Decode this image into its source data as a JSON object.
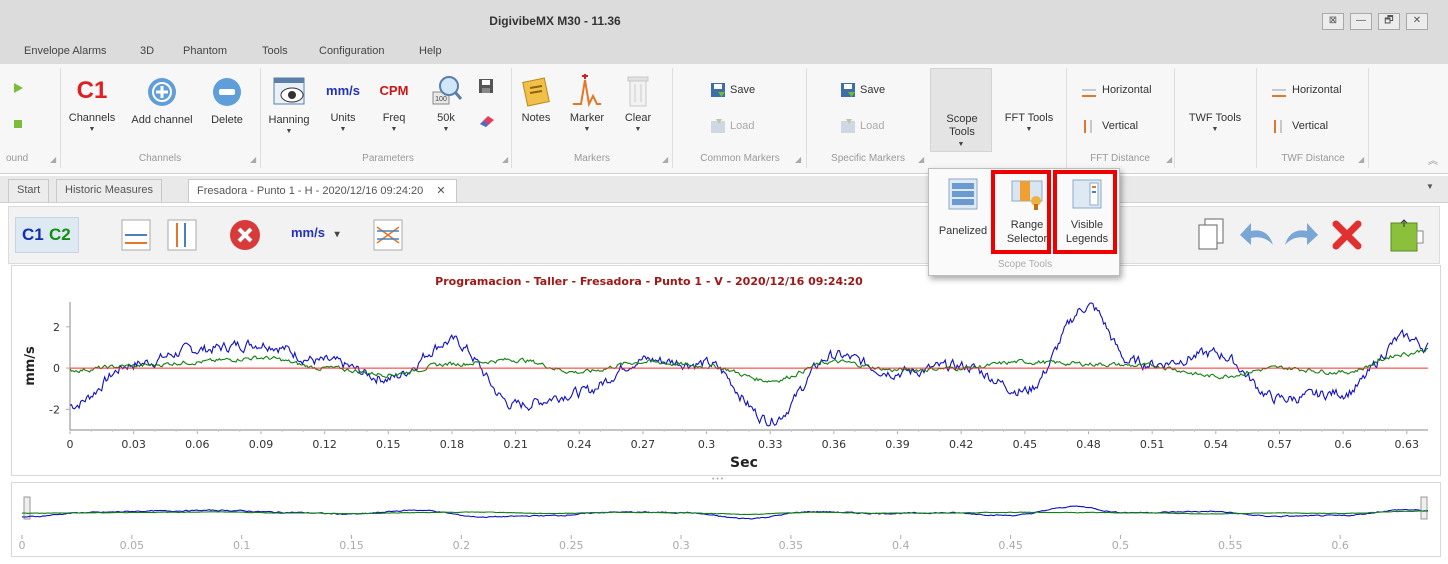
{
  "window": {
    "title": "DigivibeMX M30 - 11.36",
    "controls": [
      "⊠",
      "—",
      "🗗",
      "✕"
    ]
  },
  "menu": [
    "Envelope Alarms",
    "3D",
    "Phantom",
    "Tools",
    "Configuration",
    "Help"
  ],
  "ribbon": {
    "cut_group": {
      "label": "ound"
    },
    "channels": {
      "label": "Channels",
      "c1_badge": "C1",
      "buttons": [
        "Channels",
        "Add channel",
        "Delete"
      ]
    },
    "parameters": {
      "label": "Parameters",
      "units_text": "mm/s",
      "freq_text": "CPM",
      "hanning_badge": "100",
      "buttons": [
        "Hanning",
        "Units",
        "Freq",
        "50k"
      ]
    },
    "markers": {
      "label": "Markers",
      "buttons": [
        "Notes",
        "Marker",
        "Clear"
      ]
    },
    "common_markers": {
      "label": "Common Markers",
      "save": "Save",
      "load": "Load"
    },
    "specific_markers": {
      "label": "Specific Markers",
      "save": "Save",
      "load": "Load"
    },
    "scope_tools": {
      "label": "Scope Tools"
    },
    "fft_tools": {
      "label": "FFT Tools"
    },
    "fft_distance": {
      "label": "FFT Distance",
      "horizontal": "Horizontal",
      "vertical": "Vertical"
    },
    "twf_tools": {
      "label": "TWF Tools"
    },
    "twf_distance": {
      "label": "TWF Distance",
      "horizontal": "Horizontal",
      "vertical": "Vertical"
    }
  },
  "tabs": [
    {
      "label": "Start"
    },
    {
      "label": "Historic Measures"
    },
    {
      "label": "Fresadora - Punto 1 - H - 2020/12/16 09:24:20",
      "close": "✕"
    }
  ],
  "toolbar": {
    "c1": "C1",
    "c2": "C2",
    "units": "mm/s",
    "units_arrow": "▾"
  },
  "popup": {
    "buttons": [
      "Panelized",
      "Range Selector",
      "Visible Legends"
    ],
    "group_label": "Scope Tools"
  },
  "chart_data": [
    {
      "type": "line",
      "title": "Programacion - Taller - Fresadora - Punto 1 - V - 2020/12/16 09:24:20",
      "xlabel": "Sec",
      "ylabel": "mm/s",
      "xlim": [
        0,
        0.64
      ],
      "ylim": [
        -3,
        3.2
      ],
      "x_ticks": [
        "0",
        "0.03",
        "0.06",
        "0.09",
        "0.12",
        "0.15",
        "0.18",
        "0.21",
        "0.24",
        "0.27",
        "0.3",
        "0.33",
        "0.36",
        "0.39",
        "0.42",
        "0.45",
        "0.48",
        "0.51",
        "0.54",
        "0.57",
        "0.6",
        "0.63"
      ],
      "y_ticks": [
        "2",
        "0",
        "-2"
      ],
      "series": [
        {
          "color": "#1010c8",
          "x": [
            0,
            0.03,
            0.06,
            0.09,
            0.12,
            0.15,
            0.18,
            0.21,
            0.24,
            0.27,
            0.3,
            0.33,
            0.36,
            0.39,
            0.42,
            0.45,
            0.48,
            0.5,
            0.51,
            0.54,
            0.57,
            0.6,
            0.63,
            0.64
          ],
          "y": [
            -1.8,
            0.2,
            0.9,
            1.2,
            0.3,
            -0.5,
            1.3,
            -1.8,
            -1.2,
            0.4,
            0.2,
            -2.5,
            0.6,
            -0.2,
            0.1,
            -1.1,
            3.0,
            0.3,
            0.2,
            0.7,
            -1.5,
            -1.2,
            1.5,
            1.0
          ]
        },
        {
          "color": "#108010",
          "x": [
            0,
            0.03,
            0.06,
            0.09,
            0.12,
            0.15,
            0.18,
            0.21,
            0.24,
            0.27,
            0.3,
            0.33,
            0.36,
            0.39,
            0.42,
            0.45,
            0.48,
            0.51,
            0.54,
            0.57,
            0.6,
            0.63,
            0.64
          ],
          "y": [
            -0.1,
            0.1,
            0.3,
            0.5,
            0.0,
            -0.3,
            0.2,
            0.4,
            -0.2,
            0.3,
            0.1,
            -0.6,
            0.3,
            -0.1,
            0.0,
            0.3,
            0.2,
            0.1,
            -0.4,
            0.0,
            -0.2,
            0.7,
            0.9
          ]
        },
        {
          "color": "#ff2a2a",
          "x": [
            0,
            0.64
          ],
          "y": [
            0,
            0
          ]
        }
      ]
    },
    {
      "type": "line",
      "title": "",
      "xlim": [
        0,
        0.64
      ],
      "x_ticks": [
        "0",
        "0.05",
        "0.1",
        "0.15",
        "0.2",
        "0.25",
        "0.3",
        "0.35",
        "0.4",
        "0.45",
        "0.5",
        "0.55",
        "0.6"
      ],
      "series": [
        {
          "color": "#1010c8",
          "ref": 0
        },
        {
          "color": "#108010",
          "ref": 1
        }
      ]
    }
  ]
}
